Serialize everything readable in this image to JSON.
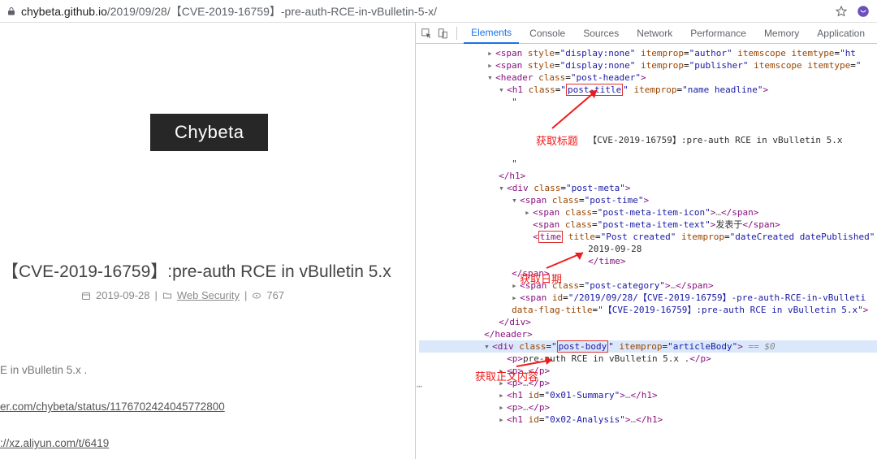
{
  "browser": {
    "url_host": "chybeta.github.io",
    "url_path": "/2019/09/28/【CVE-2019-16759】-pre-auth-RCE-in-vBulletin-5-x/"
  },
  "page": {
    "logo": "Chybeta",
    "title": "【CVE-2019-16759】:pre-auth RCE in vBulletin 5.x",
    "date": "2019-09-28",
    "category": "Web Security",
    "views": "767",
    "body_fragment": "E in vBulletin 5.x .",
    "link1": "er.com/chybeta/status/1176702424045772800",
    "link2": "://xz.aliyun.com/t/6419"
  },
  "devtools": {
    "tabs": [
      "Elements",
      "Console",
      "Sources",
      "Network",
      "Performance",
      "Memory",
      "Application"
    ],
    "active_tab": 0,
    "dom": {
      "author_attrs": "style=\"display:none\" itemprop=\"author\" itemscope itemtype=\"ht",
      "publisher_attrs": "style=\"display:none\" itemprop=\"publisher\" itemscope itemtype=",
      "header_class": "post-header",
      "h1_class": "post-title",
      "h1_itemprop": "name headline",
      "h1_text": "【CVE-2019-16759】:pre-auth RCE in vBulletin 5.x",
      "meta_class": "post-meta",
      "time_span_class": "post-time",
      "icon_span_class": "post-meta-item-icon",
      "text_span_class": "post-meta-item-text",
      "text_span_txt": "发表于",
      "time_title": "Post created",
      "time_itemprop": "dateCreated datePublished",
      "time_text": "2019-09-28",
      "cat_span_class": "post-category",
      "span_id": "/2019/09/28/【CVE-2019-16759】-pre-auth-RCE-in-vBulleti",
      "data_flag_title": "【CVE-2019-16759】:pre-auth RCE in vBulletin 5.x\"",
      "body_class": "post-body",
      "body_itemprop": "articleBody",
      "p_text": "pre-auth RCE in vBulletin 5.x .",
      "h1a_id": "0x01-Summary",
      "h1b_id": "0x02-Analysis"
    }
  },
  "annotations": {
    "a1": "获取标题",
    "a2": "获取日期",
    "a3": "获取正文内容"
  }
}
